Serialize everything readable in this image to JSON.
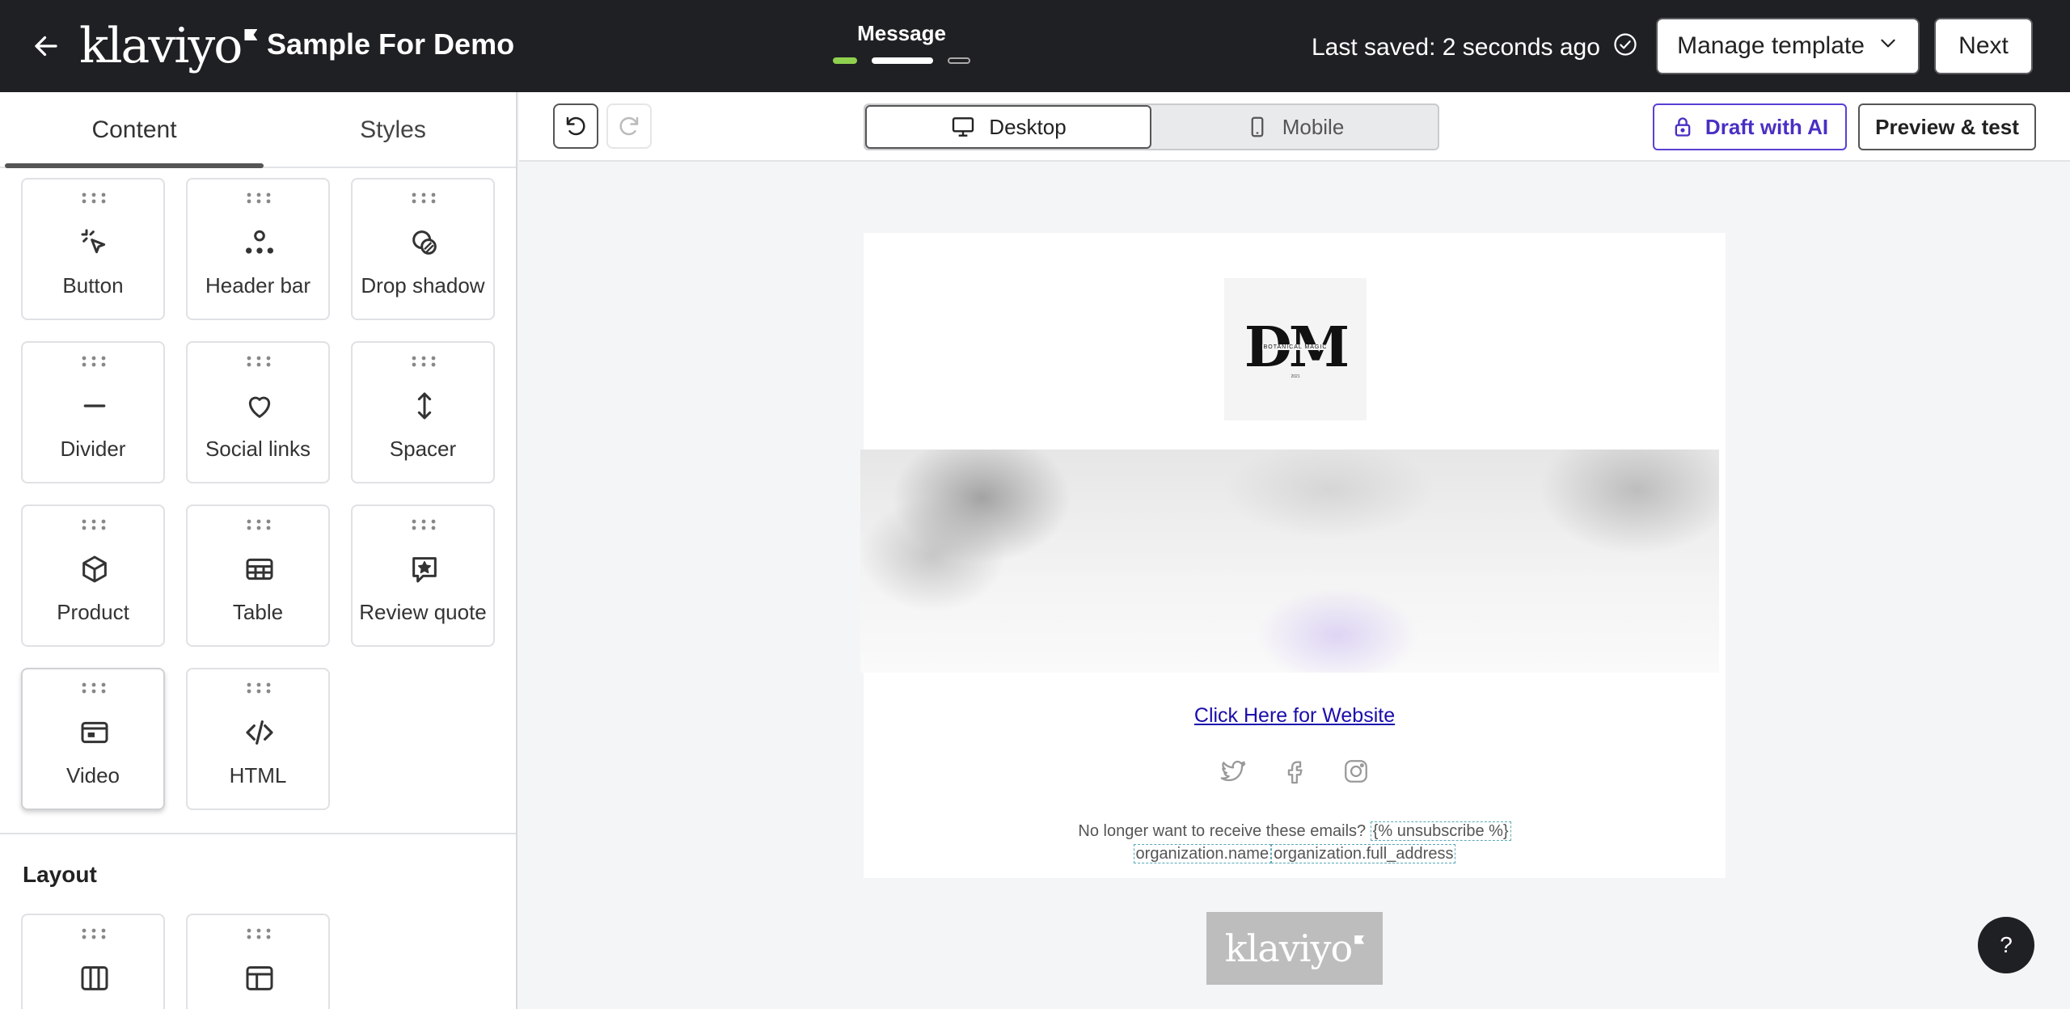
{
  "header": {
    "logo_text": "klaviyo",
    "doc_title": "Sample For Demo",
    "step_label": "Message",
    "saved_text": "Last saved: 2 seconds ago",
    "manage_label": "Manage template",
    "next_label": "Next"
  },
  "sidebar": {
    "tabs": [
      {
        "label": "Content"
      },
      {
        "label": "Styles"
      }
    ],
    "blocks": [
      {
        "label": "Button",
        "icon": "pointer-icon"
      },
      {
        "label": "Header bar",
        "icon": "header-bar-icon"
      },
      {
        "label": "Drop shadow",
        "icon": "drop-shadow-icon"
      },
      {
        "label": "Divider",
        "icon": "divider-icon"
      },
      {
        "label": "Social links",
        "icon": "heart-icon"
      },
      {
        "label": "Spacer",
        "icon": "spacer-icon"
      },
      {
        "label": "Product",
        "icon": "cube-icon"
      },
      {
        "label": "Table",
        "icon": "table-icon"
      },
      {
        "label": "Review quote",
        "icon": "review-icon"
      },
      {
        "label": "Video",
        "icon": "video-icon"
      },
      {
        "label": "HTML",
        "icon": "code-icon"
      }
    ],
    "layout_title": "Layout"
  },
  "toolbar": {
    "desktop_label": "Desktop",
    "mobile_label": "Mobile",
    "draft_label": "Draft with AI",
    "preview_label": "Preview & test"
  },
  "email": {
    "logo_text": "DM",
    "logo_subtext": "BOTANICAL MAGIC",
    "logo_year": "2021",
    "link_text": "Click Here for Website",
    "footer_prefix": "No longer want to receive these emails?",
    "unsubscribe_tag": "{% unsubscribe %}",
    "org_name_tag": "organization.name",
    "org_address_tag": "organization.full_address"
  },
  "powered_by": "klaviyo",
  "help_label": "?",
  "colors": {
    "topbar": "#1f2023",
    "accent_purple": "#5b3fd4",
    "step_done": "#8fd14f",
    "link": "#1a0dab"
  }
}
